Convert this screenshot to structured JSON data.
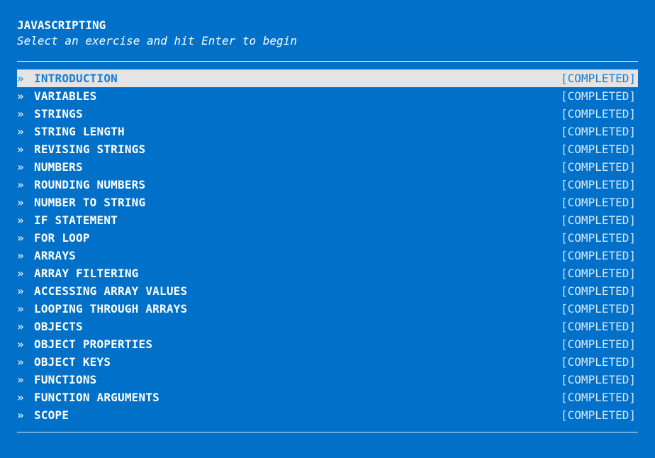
{
  "header": {
    "title": "JAVASCRIPTING",
    "subtitle": "Select an exercise and hit Enter to begin"
  },
  "menu": {
    "marker": "»",
    "selected_index": 0,
    "items": [
      {
        "name": "INTRODUCTION",
        "status": "[COMPLETED]"
      },
      {
        "name": "VARIABLES",
        "status": "[COMPLETED]"
      },
      {
        "name": "STRINGS",
        "status": "[COMPLETED]"
      },
      {
        "name": "STRING LENGTH",
        "status": "[COMPLETED]"
      },
      {
        "name": "REVISING STRINGS",
        "status": "[COMPLETED]"
      },
      {
        "name": "NUMBERS",
        "status": "[COMPLETED]"
      },
      {
        "name": "ROUNDING NUMBERS",
        "status": "[COMPLETED]"
      },
      {
        "name": "NUMBER TO STRING",
        "status": "[COMPLETED]"
      },
      {
        "name": "IF STATEMENT",
        "status": "[COMPLETED]"
      },
      {
        "name": "FOR LOOP",
        "status": "[COMPLETED]"
      },
      {
        "name": "ARRAYS",
        "status": "[COMPLETED]"
      },
      {
        "name": "ARRAY FILTERING",
        "status": "[COMPLETED]"
      },
      {
        "name": "ACCESSING ARRAY VALUES",
        "status": "[COMPLETED]"
      },
      {
        "name": "LOOPING THROUGH ARRAYS",
        "status": "[COMPLETED]"
      },
      {
        "name": "OBJECTS",
        "status": "[COMPLETED]"
      },
      {
        "name": "OBJECT PROPERTIES",
        "status": "[COMPLETED]"
      },
      {
        "name": "OBJECT KEYS",
        "status": "[COMPLETED]"
      },
      {
        "name": "FUNCTIONS",
        "status": "[COMPLETED]"
      },
      {
        "name": "FUNCTION ARGUMENTS",
        "status": "[COMPLETED]"
      },
      {
        "name": "SCOPE",
        "status": "[COMPLETED]"
      }
    ]
  },
  "colors": {
    "background": "#0070c8",
    "text": "#ffffff",
    "selected_background": "#e4e4e4",
    "selected_text": "#1a7fd4"
  }
}
